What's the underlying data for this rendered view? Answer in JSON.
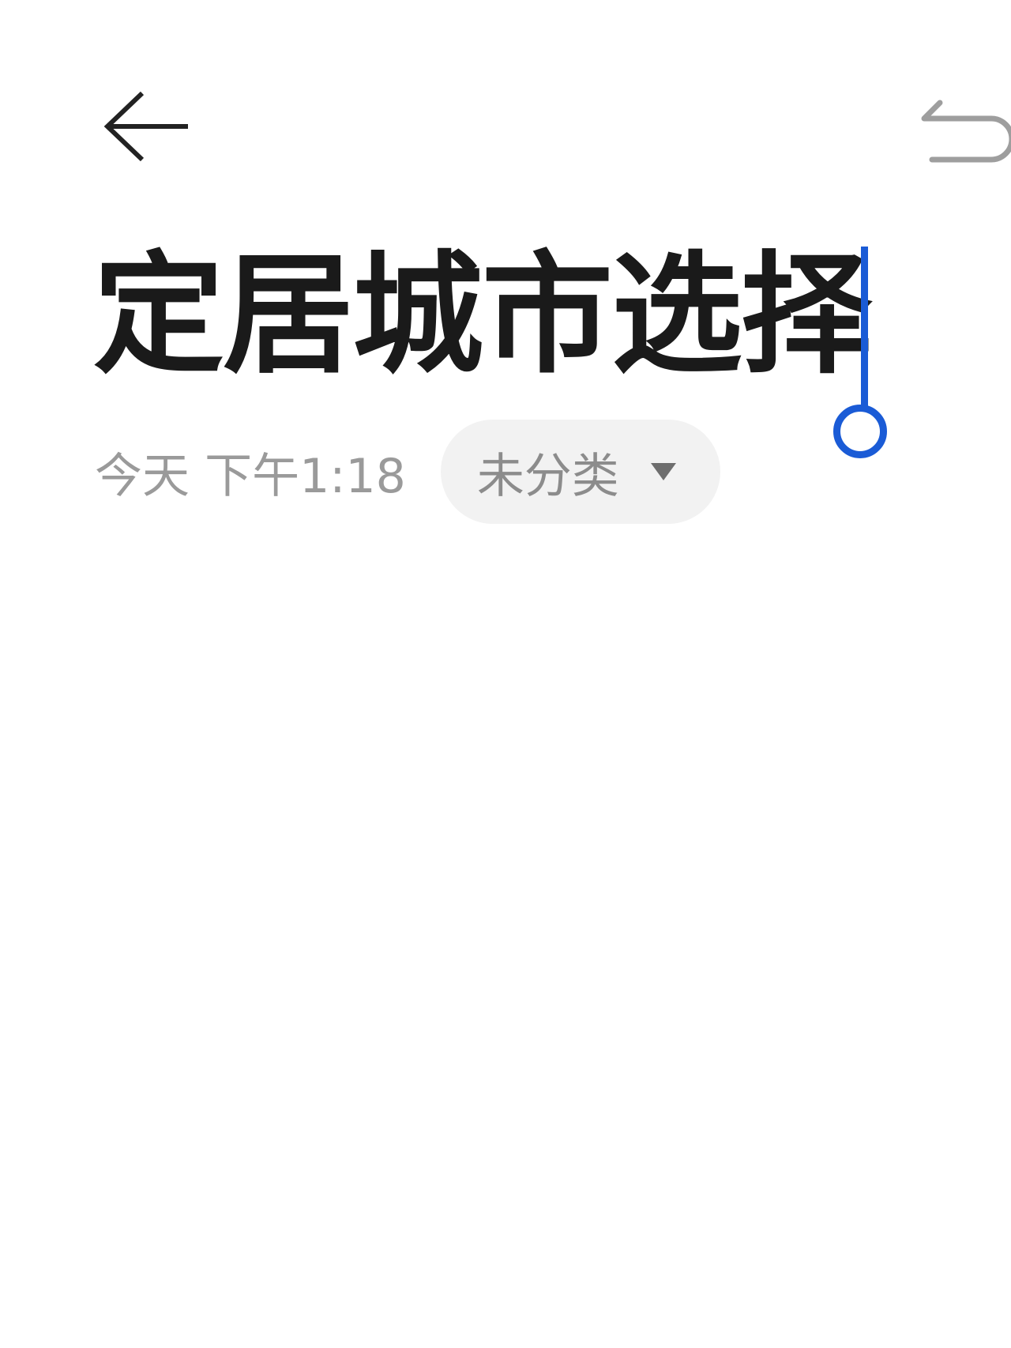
{
  "header": {
    "back_icon": "arrow-left-icon",
    "undo_icon": "undo-icon",
    "icon_color": "#222222",
    "undo_color": "#9e9e9e"
  },
  "note": {
    "title": "定居城市选择",
    "date": "今天 下午1:18",
    "category": "未分类",
    "category_icon": "caret-down-icon"
  },
  "colors": {
    "caret": "#1a5bd6",
    "text_primary": "#1a1a1a",
    "text_secondary": "#9a9a9a",
    "chip_bg": "#f2f2f2"
  }
}
